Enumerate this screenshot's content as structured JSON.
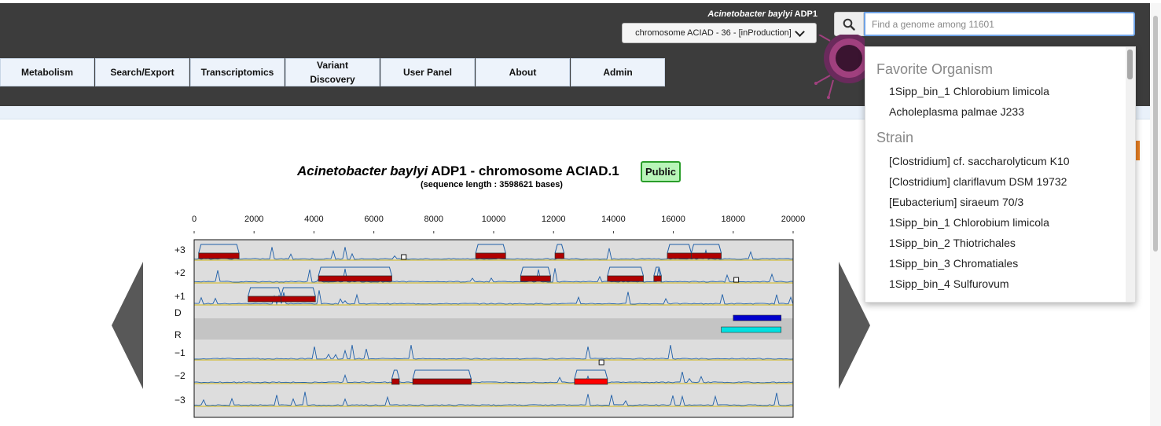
{
  "header": {
    "organism_species": "Acinetobacter baylyi",
    "organism_strain": " ADP1",
    "chromosome_select": "chromosome ACIAD - 36 - [inProduction]",
    "search_placeholder": "Find a genome among 11601"
  },
  "nav": {
    "items": [
      {
        "label": "Metabolism"
      },
      {
        "label": "Search/Export"
      },
      {
        "label": "Transcriptomics"
      },
      {
        "label": "Variant Discovery"
      },
      {
        "label": "User Panel"
      },
      {
        "label": "About"
      },
      {
        "label": "Admin"
      }
    ]
  },
  "dropdown": {
    "groups": [
      {
        "label": "Favorite Organism",
        "items": [
          "1Sipp_bin_1 Chlorobium limicola",
          "Acholeplasma palmae J233"
        ]
      },
      {
        "label": "Strain",
        "items": [
          "[Clostridium] cf. saccharolyticum K10",
          "[Clostridium] clariflavum DSM 19732",
          "[Eubacterium] siraeum 70/3",
          "1Sipp_bin_1 Chlorobium limicola",
          "1Sipp_bin_2 Thiotrichales",
          "1Sipp_bin_3 Chromatiales",
          "1Sipp_bin_4 Sulfurovum"
        ]
      }
    ]
  },
  "main": {
    "title_species": "Acinetobacter baylyi",
    "title_rest": " ADP1 - chromosome ACIAD.1",
    "badge": "Public",
    "sequence_length": "(sequence length : 3598621 bases)"
  },
  "viewer": {
    "axis_ticks": [
      "0",
      "2000",
      "4000",
      "6000",
      "8000",
      "10000",
      "12000",
      "14000",
      "16000",
      "18000",
      "20000"
    ],
    "track_labels": [
      "+3",
      "+2",
      "+1",
      "D",
      "R",
      "−1",
      "−2",
      "−3"
    ],
    "colors": {
      "gene": "#b00000",
      "gene_highlight": "#ff0000",
      "signal": "#1f5fa8",
      "strand_d": "#0000cc",
      "strand_r": "#00e0e0",
      "baseline": "#d4c040",
      "track_bg": "#dddddd",
      "band_bg": "#c4c4c4"
    },
    "genes": [
      {
        "track": "+3",
        "start": 150,
        "end": 1500
      },
      {
        "track": "+3",
        "start": 9400,
        "end": 10400
      },
      {
        "track": "+3",
        "start": 12050,
        "end": 12350
      },
      {
        "track": "+3",
        "start": 15800,
        "end": 16600
      },
      {
        "track": "+3",
        "start": 16600,
        "end": 17600
      },
      {
        "track": "+2",
        "start": 4150,
        "end": 6600
      },
      {
        "track": "+2",
        "start": 10900,
        "end": 11900
      },
      {
        "track": "+2",
        "start": 13800,
        "end": 15000
      },
      {
        "track": "+2",
        "start": 15350,
        "end": 15600
      },
      {
        "track": "+1",
        "start": 1800,
        "end": 2900
      },
      {
        "track": "+1",
        "start": 2900,
        "end": 4050
      },
      {
        "track": "−2",
        "start": 6600,
        "end": 6850
      },
      {
        "track": "−2",
        "start": 7300,
        "end": 9250
      },
      {
        "track": "−2",
        "start": 12700,
        "end": 13800,
        "highlight": true
      }
    ],
    "strand_bars": [
      {
        "track": "D",
        "start": 18000,
        "end": 19600
      },
      {
        "track": "R",
        "start": 17600,
        "end": 19600
      }
    ],
    "markers": [
      {
        "track": "+3",
        "pos": 7000
      },
      {
        "track": "+2",
        "pos": 18100
      },
      {
        "track": "−1",
        "pos": 13600
      }
    ]
  }
}
